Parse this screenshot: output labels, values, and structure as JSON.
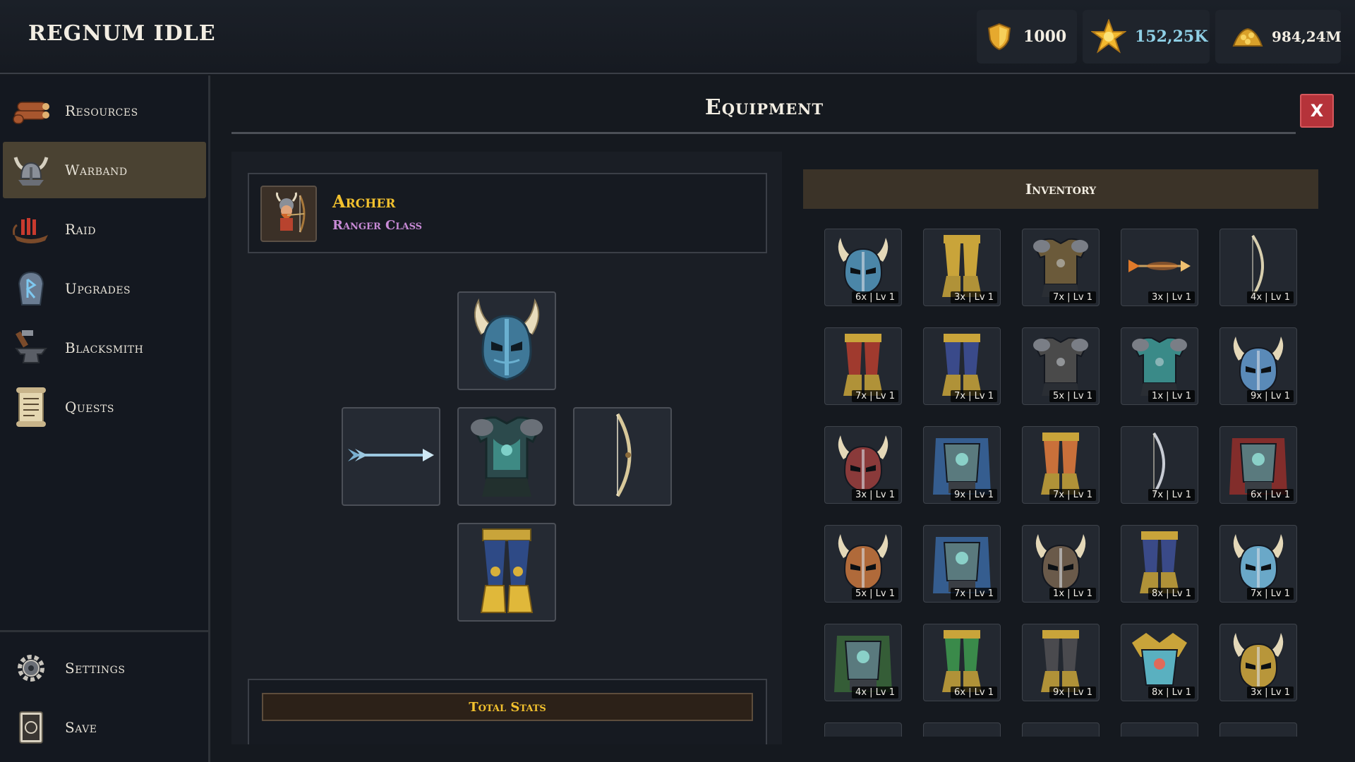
{
  "app": {
    "title": "REGNUM IDLE"
  },
  "resources": {
    "shield": {
      "icon": "shield-icon",
      "value": "1000",
      "color": "#f2ede2"
    },
    "star": {
      "icon": "star-icon",
      "value": "152,25K",
      "color": "#8fd0e6"
    },
    "gold": {
      "icon": "gold-pile-icon",
      "value": "984,24M",
      "color": "#f2ede2"
    }
  },
  "sidebar": {
    "items": [
      {
        "label": "Resources",
        "icon": "logs-icon"
      },
      {
        "label": "Warband",
        "icon": "viking-helmet-icon",
        "active": true
      },
      {
        "label": "Raid",
        "icon": "longship-icon"
      },
      {
        "label": "Upgrades",
        "icon": "rune-stone-icon"
      },
      {
        "label": "Blacksmith",
        "icon": "anvil-icon"
      },
      {
        "label": "Quests",
        "icon": "scroll-icon"
      }
    ],
    "bottom": [
      {
        "label": "Settings",
        "icon": "gear-icon"
      },
      {
        "label": "Save",
        "icon": "save-book-icon"
      }
    ]
  },
  "equipment": {
    "title": "Equipment",
    "close_label": "X",
    "character": {
      "name": "Archer",
      "class": "Ranger Class",
      "icon": "archer-portrait-icon"
    },
    "slots": {
      "head": "blue-horned-helmet-icon",
      "weapon": "arrow-icon",
      "chest": "teal-chest-armor-icon",
      "offhand": "bow-icon",
      "legs": "gold-leg-armor-icon"
    },
    "total_stats_label": "Total Stats"
  },
  "inventory": {
    "title": "Inventory",
    "items": [
      {
        "icon": "blue-horned-helmet-icon",
        "label": "6x | Lv 1",
        "color": "#4b86a8"
      },
      {
        "icon": "gold-leg-armor-icon",
        "label": "3x | Lv 1",
        "color": "#c9a43a"
      },
      {
        "icon": "dark-gold-chest-armor-icon",
        "label": "7x | Lv 1",
        "color": "#6b5a3a"
      },
      {
        "icon": "fire-arrow-icon",
        "label": "3x | Lv 1",
        "color": "#e07a2a"
      },
      {
        "icon": "bone-bow-icon",
        "label": "4x | Lv 1",
        "color": "#d8cfae"
      },
      {
        "icon": "red-gold-leg-armor-icon",
        "label": "7x | Lv 1",
        "color": "#a03a2e"
      },
      {
        "icon": "blue-gold-leg-armor-icon",
        "label": "7x | Lv 1",
        "color": "#3a4a8a"
      },
      {
        "icon": "black-chest-armor-icon",
        "label": "5x | Lv 1",
        "color": "#4a4a4a"
      },
      {
        "icon": "teal-chest-armor-icon",
        "label": "1x | Lv 1",
        "color": "#3a8a88"
      },
      {
        "icon": "frost-horned-helmet-icon",
        "label": "9x | Lv 1",
        "color": "#5a8ab8"
      },
      {
        "icon": "demon-horned-helmet-icon",
        "label": "3x | Lv 1",
        "color": "#8a3a3a"
      },
      {
        "icon": "blue-caped-chest-armor-icon",
        "label": "9x | Lv 1",
        "color": "#3a6aa8"
      },
      {
        "icon": "orange-blue-leg-armor-icon",
        "label": "7x | Lv 1",
        "color": "#c9703a"
      },
      {
        "icon": "silver-bow-icon",
        "label": "7x | Lv 1",
        "color": "#c8ccd4"
      },
      {
        "icon": "red-caped-chest-armor-icon",
        "label": "6x | Lv 1",
        "color": "#9a2e2a"
      },
      {
        "icon": "copper-horned-helmet-icon",
        "label": "5x | Lv 1",
        "color": "#b06a3a"
      },
      {
        "icon": "blue-caped-chest-armor-icon",
        "label": "7x | Lv 1",
        "color": "#3a6aa8"
      },
      {
        "icon": "dark-horned-helmet-icon",
        "label": "1x | Lv 1",
        "color": "#6a5a4a"
      },
      {
        "icon": "navy-leg-armor-icon",
        "label": "8x | Lv 1",
        "color": "#3a4a88"
      },
      {
        "icon": "ice-horned-helmet-icon",
        "label": "7x | Lv 1",
        "color": "#6aa8c8"
      },
      {
        "icon": "green-caped-chest-armor-icon",
        "label": "4x | Lv 1",
        "color": "#3a6a3a"
      },
      {
        "icon": "green-leg-armor-icon",
        "label": "6x | Lv 1",
        "color": "#3a8a4a"
      },
      {
        "icon": "black-leg-armor-icon",
        "label": "9x | Lv 1",
        "color": "#4a4a4e"
      },
      {
        "icon": "cyan-pauldron-chest-icon",
        "label": "8x | Lv 1",
        "color": "#5ab0c0"
      },
      {
        "icon": "gold-horned-helmet-icon",
        "label": "3x | Lv 1",
        "color": "#b8963a"
      }
    ]
  }
}
